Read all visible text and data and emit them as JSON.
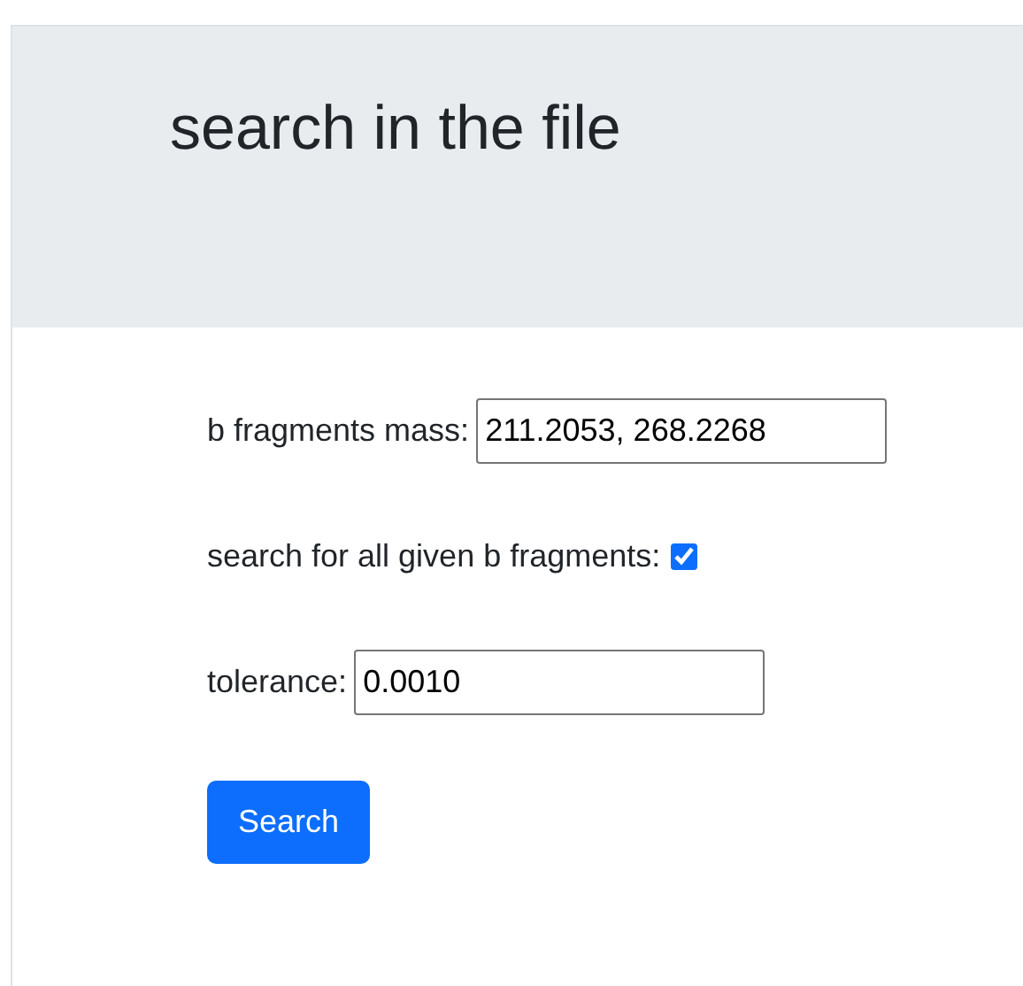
{
  "header": {
    "title": "search in the file"
  },
  "form": {
    "fields": [
      {
        "kind": "text",
        "label": "b fragments mass:",
        "value": "211.2053, 268.2268"
      },
      {
        "kind": "checkbox",
        "label": "search for all given b fragments:",
        "checked": true
      },
      {
        "kind": "text",
        "label": "tolerance:",
        "value": "0.0010"
      }
    ],
    "button": "Search"
  }
}
